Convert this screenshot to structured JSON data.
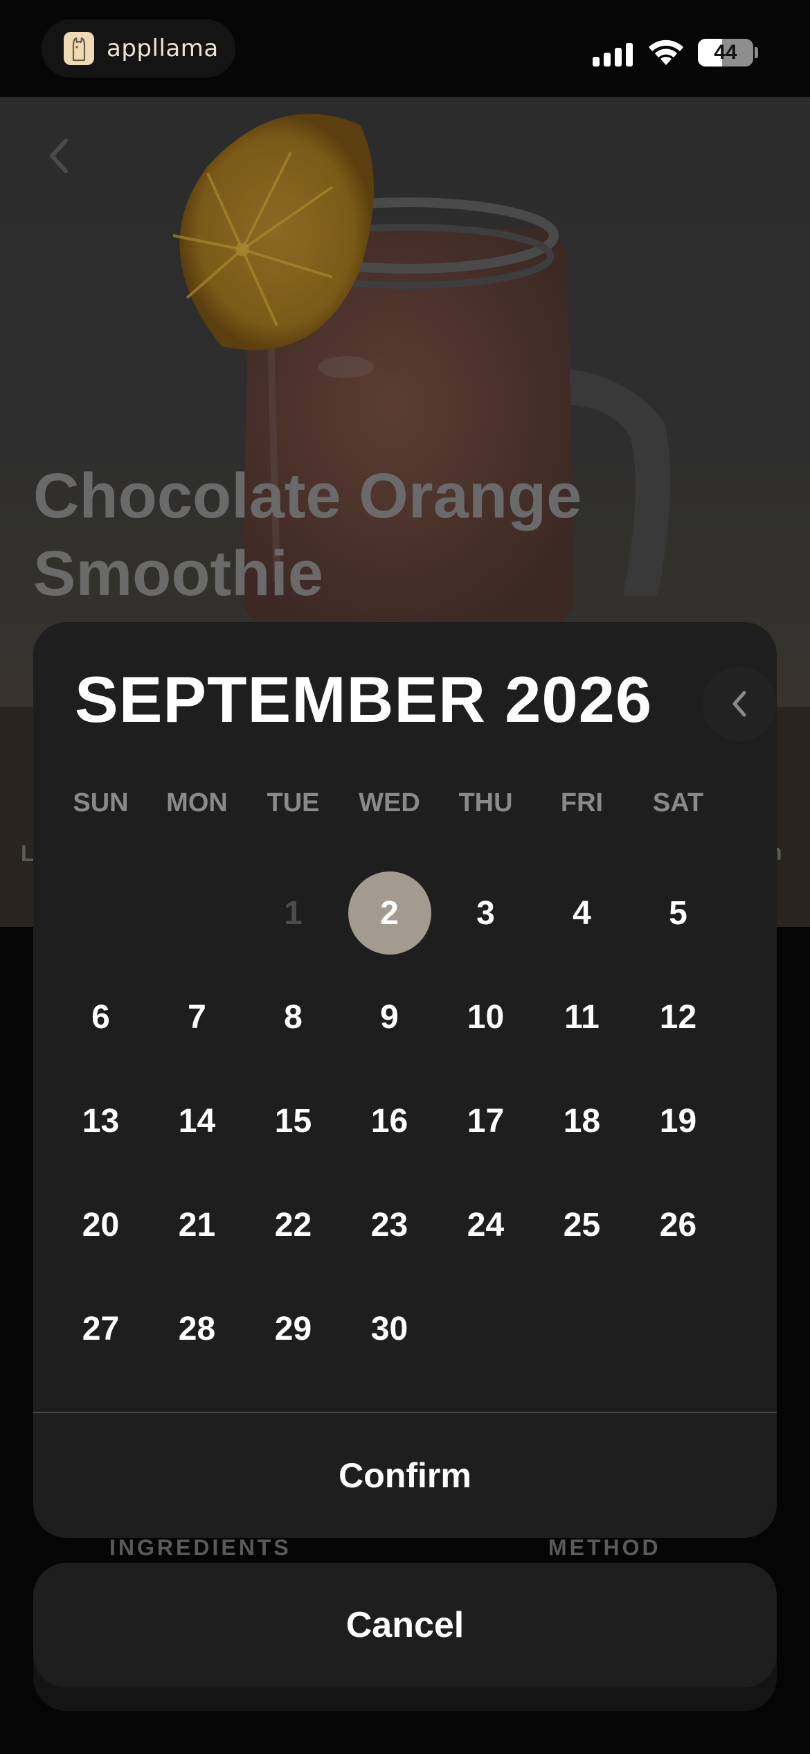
{
  "status_bar": {
    "brand_name": "appllama",
    "battery_percent": 44,
    "battery_label": "44",
    "signal_bars_active": 4,
    "icons": [
      "brand-logo-icon",
      "cellular-signal-icon",
      "wifi-icon",
      "battery-icon"
    ]
  },
  "recipe": {
    "title_line1": "Chocolate Orange",
    "title_line2": "Smoothie",
    "stat_left_fragment": "L",
    "stat_right_fragment": "n"
  },
  "tabs": {
    "ingredients": "INGREDIENTS",
    "method": "METHOD"
  },
  "calendar": {
    "month_title": "SEPTEMBER 2026",
    "weekdays": [
      "SUN",
      "MON",
      "TUE",
      "WED",
      "THU",
      "FRI",
      "SAT"
    ],
    "first_weekday_index": 2,
    "days_in_month": 30,
    "selected_day": 2,
    "disabled_days": [
      1
    ],
    "confirm_label": "Confirm",
    "cancel_label": "Cancel"
  },
  "colors": {
    "background": "#050505",
    "sheet": "#1e1e1e",
    "selected_day": "#a39b8d",
    "muted_text": "#8a8a8a",
    "title_dimmed": "#6a6a6a"
  }
}
